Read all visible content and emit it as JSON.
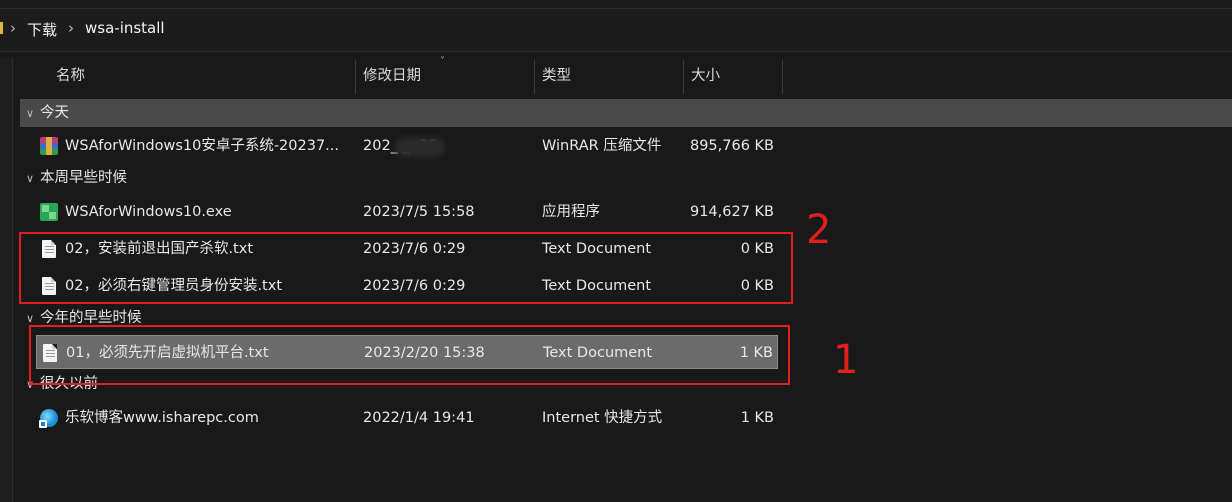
{
  "breadcrumb": {
    "items": [
      "下载",
      "wsa-install"
    ],
    "separator": "›"
  },
  "columns": {
    "name": "名称",
    "date": "修改日期",
    "type": "类型",
    "size": "大小"
  },
  "groups": [
    {
      "label": "今天",
      "rows": [
        {
          "name": "WSAforWindows10安卓子系统-20237...",
          "date": "202_ _ :39",
          "type": "WinRAR 压缩文件",
          "size": "895,766 KB",
          "icon": "rar-archive-icon"
        }
      ]
    },
    {
      "label": "本周早些时候",
      "rows": [
        {
          "name": "WSAforWindows10.exe",
          "date": "2023/7/5 15:58",
          "type": "应用程序",
          "size": "914,627 KB",
          "icon": "exe-app-icon"
        },
        {
          "name": "02，安装前退出国产杀软.txt",
          "date": "2023/7/6 0:29",
          "type": "Text Document",
          "size": "0 KB",
          "icon": "text-file-icon"
        },
        {
          "name": "02，必须右键管理员身份安装.txt",
          "date": "2023/7/6 0:29",
          "type": "Text Document",
          "size": "0 KB",
          "icon": "text-file-icon"
        }
      ]
    },
    {
      "label": "今年的早些时候",
      "rows": [
        {
          "name": "01，必须先开启虚拟机平台.txt",
          "date": "2023/2/20 15:38",
          "type": "Text Document",
          "size": "1 KB",
          "icon": "text-file-icon",
          "selected": true
        }
      ]
    },
    {
      "label": "很久以前",
      "rows": [
        {
          "name": "乐软博客www.isharepc.com",
          "date": "2022/1/4 19:41",
          "type": "Internet 快捷方式",
          "size": "1 KB",
          "icon": "internet-shortcut-icon"
        }
      ]
    }
  ],
  "annotations": [
    {
      "number": "2"
    },
    {
      "number": "1"
    }
  ],
  "colors": {
    "background": "#191919",
    "selection": "#6b6b6b",
    "annotation": "#e11f1f",
    "group_highlight": "#4a4a4a"
  }
}
